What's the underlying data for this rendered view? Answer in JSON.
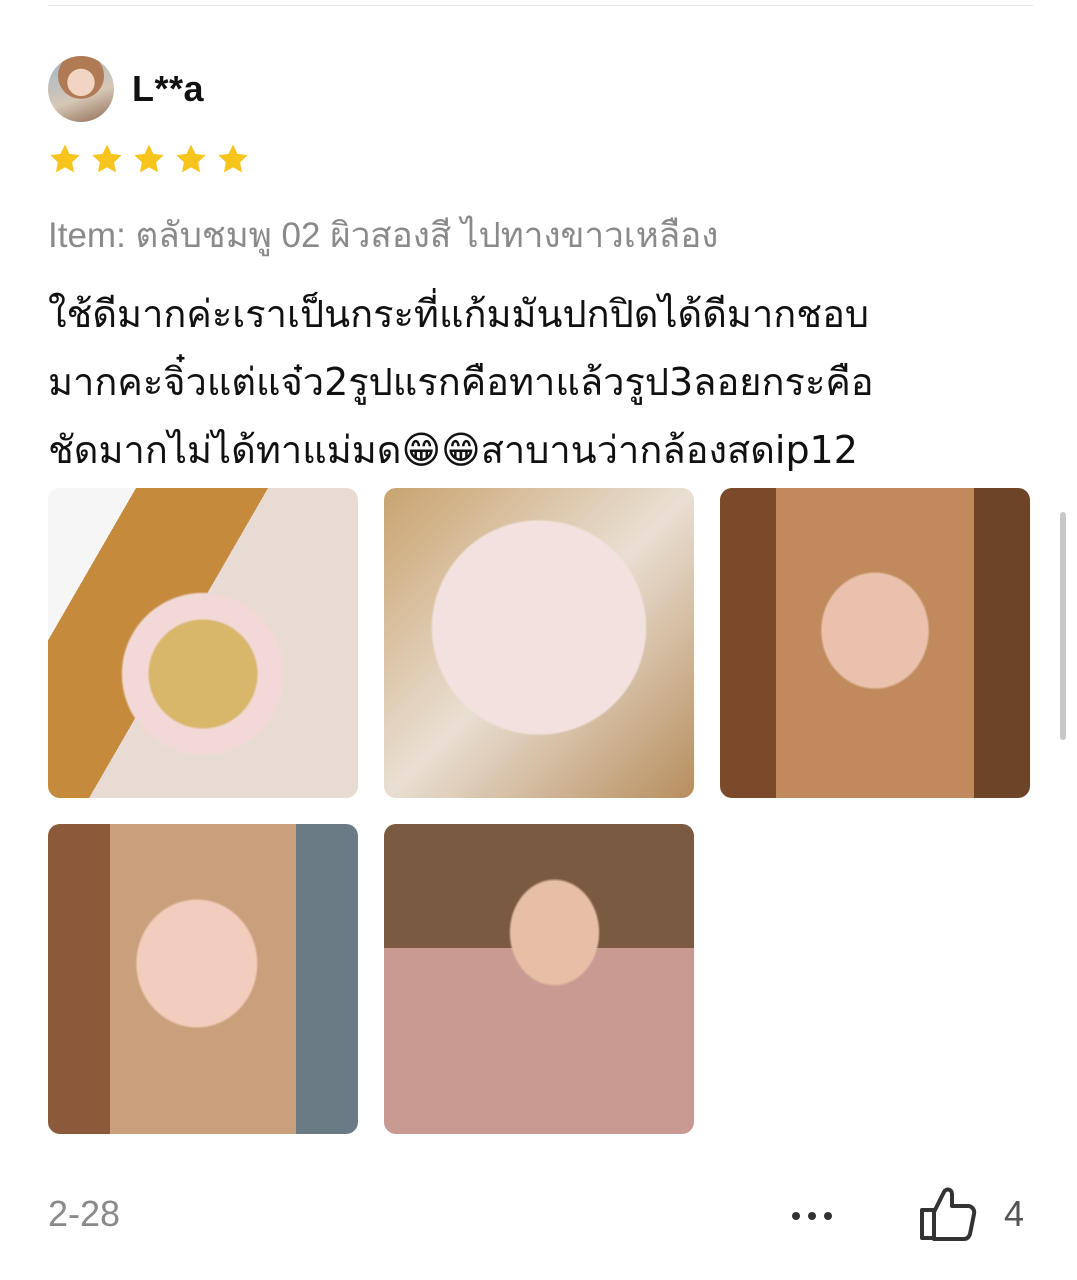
{
  "review": {
    "username": "L**a",
    "rating": 5,
    "star_color": "#f7c41b",
    "item": "Item: ตลับชมพู 02 ผิวสองสี ไปทางขาวเหลือง",
    "text": "ใช้ดีมากค่ะเราเป็นกระที่แก้มมันปกปิดได้ดีมากชอบ\nมากคะจิ๋วแต่แจ๋ว2รูปแรกคือทาแล้วรูป3ลอยกระคือ\nชัดมากไม่ได้ทาแม่มด😁😁สาบานว่ากล้องสดip12",
    "photos": [
      "product-compact-open",
      "product-compact-lid",
      "selfie-3",
      "selfie-4",
      "selfie-5"
    ],
    "date": "2-28",
    "likes": "4"
  }
}
